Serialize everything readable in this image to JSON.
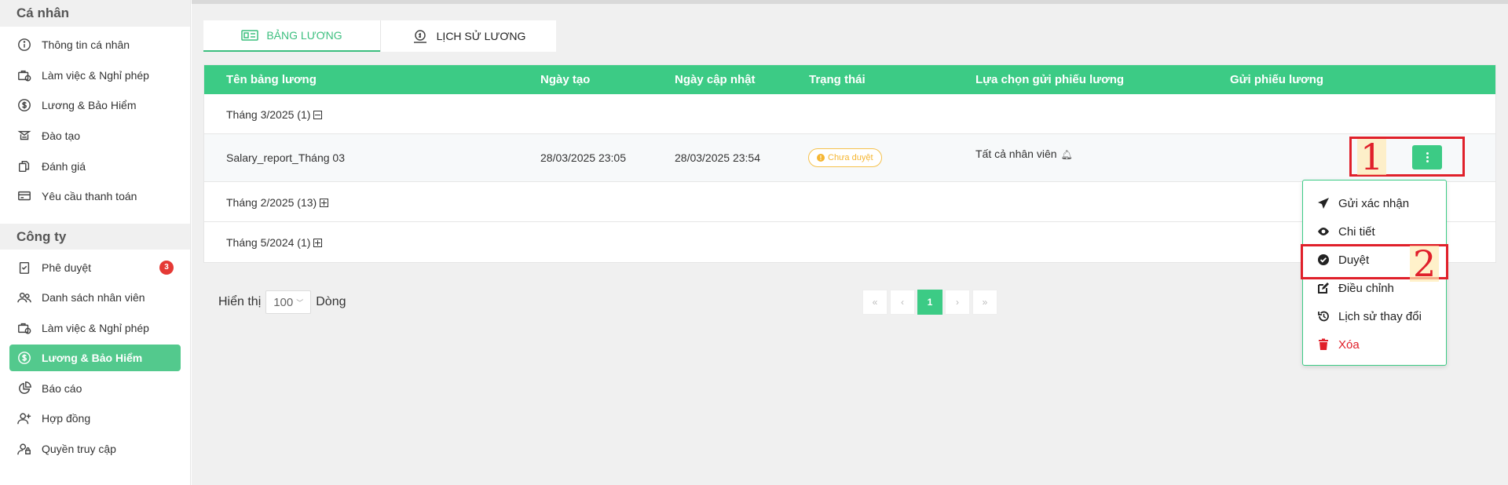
{
  "sidebar": {
    "personal": {
      "heading": "Cá nhân",
      "items": [
        {
          "label": "Thông tin cá nhân",
          "icon": "info-icon"
        },
        {
          "label": "Làm việc & Nghỉ phép",
          "icon": "briefcase-clock-icon"
        },
        {
          "label": "Lương & Bảo Hiểm",
          "icon": "dollar-circle-icon"
        },
        {
          "label": "Đào tạo",
          "icon": "graduation-icon"
        },
        {
          "label": "Đánh giá",
          "icon": "rating-icon"
        },
        {
          "label": "Yêu cầu thanh toán",
          "icon": "payment-request-icon"
        }
      ]
    },
    "company": {
      "heading": "Công ty",
      "items": [
        {
          "label": "Phê duyệt",
          "icon": "clipboard-check-icon",
          "badge": "3"
        },
        {
          "label": "Danh sách nhân viên",
          "icon": "users-icon"
        },
        {
          "label": "Làm việc & Nghỉ phép",
          "icon": "briefcase-clock-icon"
        },
        {
          "label": "Lương & Bảo Hiểm",
          "icon": "dollar-circle-icon",
          "active": true
        },
        {
          "label": "Báo cáo",
          "icon": "pie-chart-icon"
        },
        {
          "label": "Hợp đồng",
          "icon": "user-plus-icon"
        },
        {
          "label": "Quyền truy cập",
          "icon": "user-lock-icon"
        }
      ]
    }
  },
  "tabs": [
    {
      "label": "BẢNG LƯƠNG",
      "icon": "payslip-icon",
      "active": true
    },
    {
      "label": "LỊCH SỬ LƯƠNG",
      "icon": "salary-history-icon",
      "active": false
    }
  ],
  "table": {
    "headers": [
      "Tên bảng lương",
      "Ngày tạo",
      "Ngày cập nhật",
      "Trạng thái",
      "Lựa chọn gửi phiếu lương",
      "Gửi phiếu lương"
    ],
    "groups": [
      {
        "label": "Tháng 3/2025 (1)",
        "expanded": true
      },
      {
        "label": "Tháng 2/2025 (13)",
        "expanded": false
      },
      {
        "label": "Tháng 5/2024 (1)",
        "expanded": false
      }
    ],
    "row": {
      "name": "Salary_report_Tháng 03",
      "created": "28/03/2025 23:05",
      "updated": "28/03/2025 23:54",
      "status": "Chưa duyệt",
      "send_option": "Tất cả nhân viên"
    }
  },
  "annotations": [
    "1",
    "2"
  ],
  "dropdown": {
    "items": [
      {
        "label": "Gửi xác nhận",
        "icon": "send-icon"
      },
      {
        "label": "Chi tiết",
        "icon": "eye-icon"
      },
      {
        "label": "Duyệt",
        "icon": "check-circle-icon"
      },
      {
        "label": "Điều chỉnh",
        "icon": "edit-icon"
      },
      {
        "label": "Lịch sử thay đổi",
        "icon": "history-icon"
      },
      {
        "label": "Xóa",
        "icon": "trash-icon"
      }
    ]
  },
  "footer": {
    "show_label": "Hiển thị",
    "page_size": "100",
    "rows_label": "Dòng",
    "pager": [
      "«",
      "‹",
      "1",
      "›",
      "»"
    ]
  },
  "colors": {
    "accent": "#3ccb85",
    "warning": "#f5b633",
    "danger": "#e0202a"
  }
}
